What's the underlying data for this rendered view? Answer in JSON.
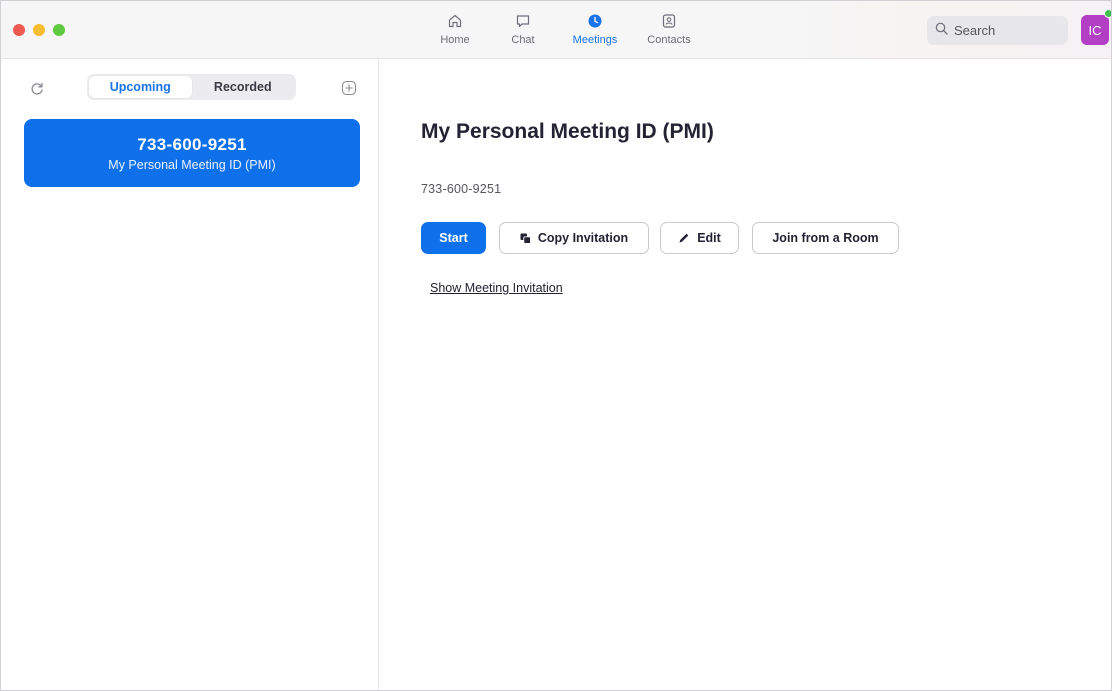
{
  "window": {
    "traffic_lights": [
      "close",
      "minimize",
      "zoom"
    ],
    "colors": {
      "close": "#ee5a52",
      "minimize": "#f5bd2f",
      "zoom": "#5fc93f"
    }
  },
  "nav": {
    "tabs": [
      {
        "label": "Home",
        "icon": "home-icon",
        "active": false
      },
      {
        "label": "Chat",
        "icon": "chat-icon",
        "active": false
      },
      {
        "label": "Meetings",
        "icon": "clock-icon",
        "active": true
      },
      {
        "label": "Contacts",
        "icon": "contacts-icon",
        "active": false
      }
    ],
    "search_label": "Search",
    "avatar_initials": "IC",
    "avatar_color": "#b23fc4",
    "presence_color": "#3fbf4f"
  },
  "sidebar": {
    "segments": [
      {
        "label": "Upcoming",
        "active": true
      },
      {
        "label": "Recorded",
        "active": false
      }
    ],
    "meetings": [
      {
        "id": "733-600-9251",
        "name": "My Personal Meeting ID (PMI)",
        "selected": true
      }
    ]
  },
  "main": {
    "title": "My Personal Meeting ID (PMI)",
    "meeting_id": "733-600-9251",
    "buttons": {
      "start": "Start",
      "copy": "Copy Invitation",
      "edit": "Edit",
      "join": "Join from a Room"
    },
    "show_invitation": "Show Meeting Invitation"
  },
  "colors": {
    "accent": "#0e71eb",
    "accent_text": "#1a73e8"
  }
}
